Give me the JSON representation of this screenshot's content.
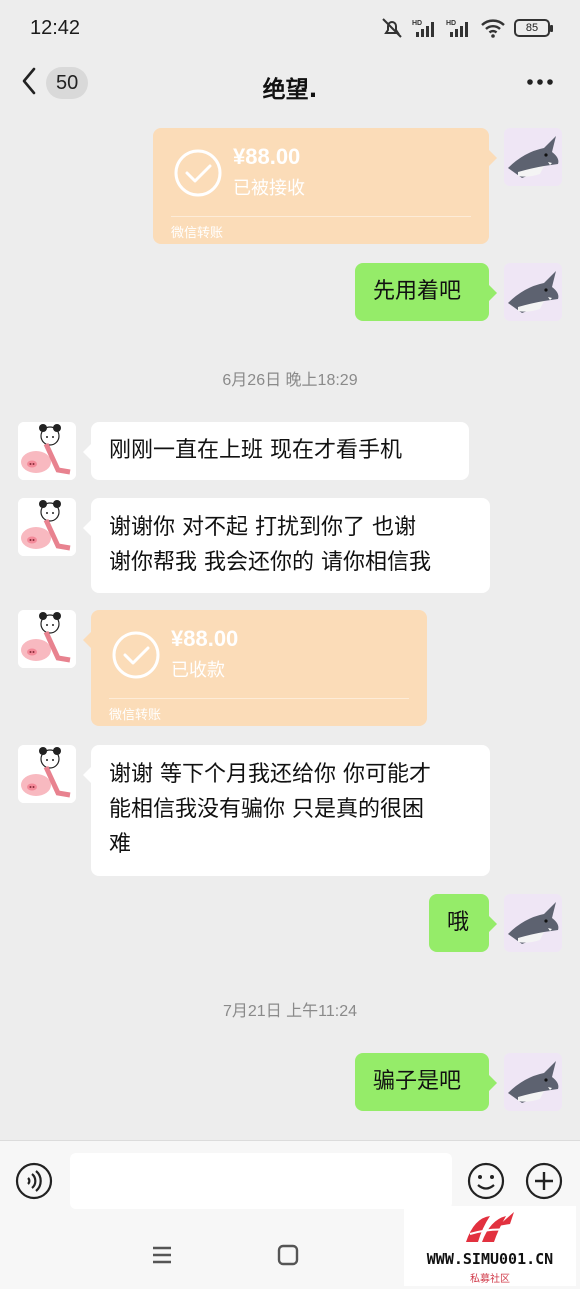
{
  "status_bar": {
    "time": "12:42",
    "battery": "85"
  },
  "header": {
    "unread_count": "50",
    "title": "绝望."
  },
  "messages": [
    {
      "type": "transfer",
      "side": "self",
      "amount": "¥88.00",
      "status": "已被接收",
      "footer": "微信转账"
    },
    {
      "type": "text",
      "side": "self",
      "text": "先用着吧"
    },
    {
      "type": "timestamp",
      "text": "6月26日 晚上18:29"
    },
    {
      "type": "text",
      "side": "peer",
      "text": "刚刚一直在上班  现在才看手机"
    },
    {
      "type": "text",
      "side": "peer",
      "line1": "谢谢你  对不起  打扰到你了  也谢",
      "line2": "谢你帮我  我会还你的  请你相信我"
    },
    {
      "type": "transfer",
      "side": "peer",
      "amount": "¥88.00",
      "status": "已收款",
      "footer": "微信转账"
    },
    {
      "type": "text",
      "side": "peer",
      "line1": "谢谢  等下个月我还给你  你可能才",
      "line2": "能相信我没有骗你  只是真的很困",
      "line3": "难"
    },
    {
      "type": "text",
      "side": "self",
      "text": "哦"
    },
    {
      "type": "timestamp",
      "text": "7月21日 上午11:24"
    },
    {
      "type": "text",
      "side": "self",
      "text": "骗子是吧"
    }
  ],
  "input": {
    "placeholder": ""
  },
  "watermark": {
    "text": "WWW.SIMU001.CN",
    "subtext": "私募社区"
  },
  "colors": {
    "background": "#ededed",
    "self_bubble": "#95ec69",
    "peer_bubble": "#ffffff",
    "transfer_card": "#fbdcb8"
  }
}
